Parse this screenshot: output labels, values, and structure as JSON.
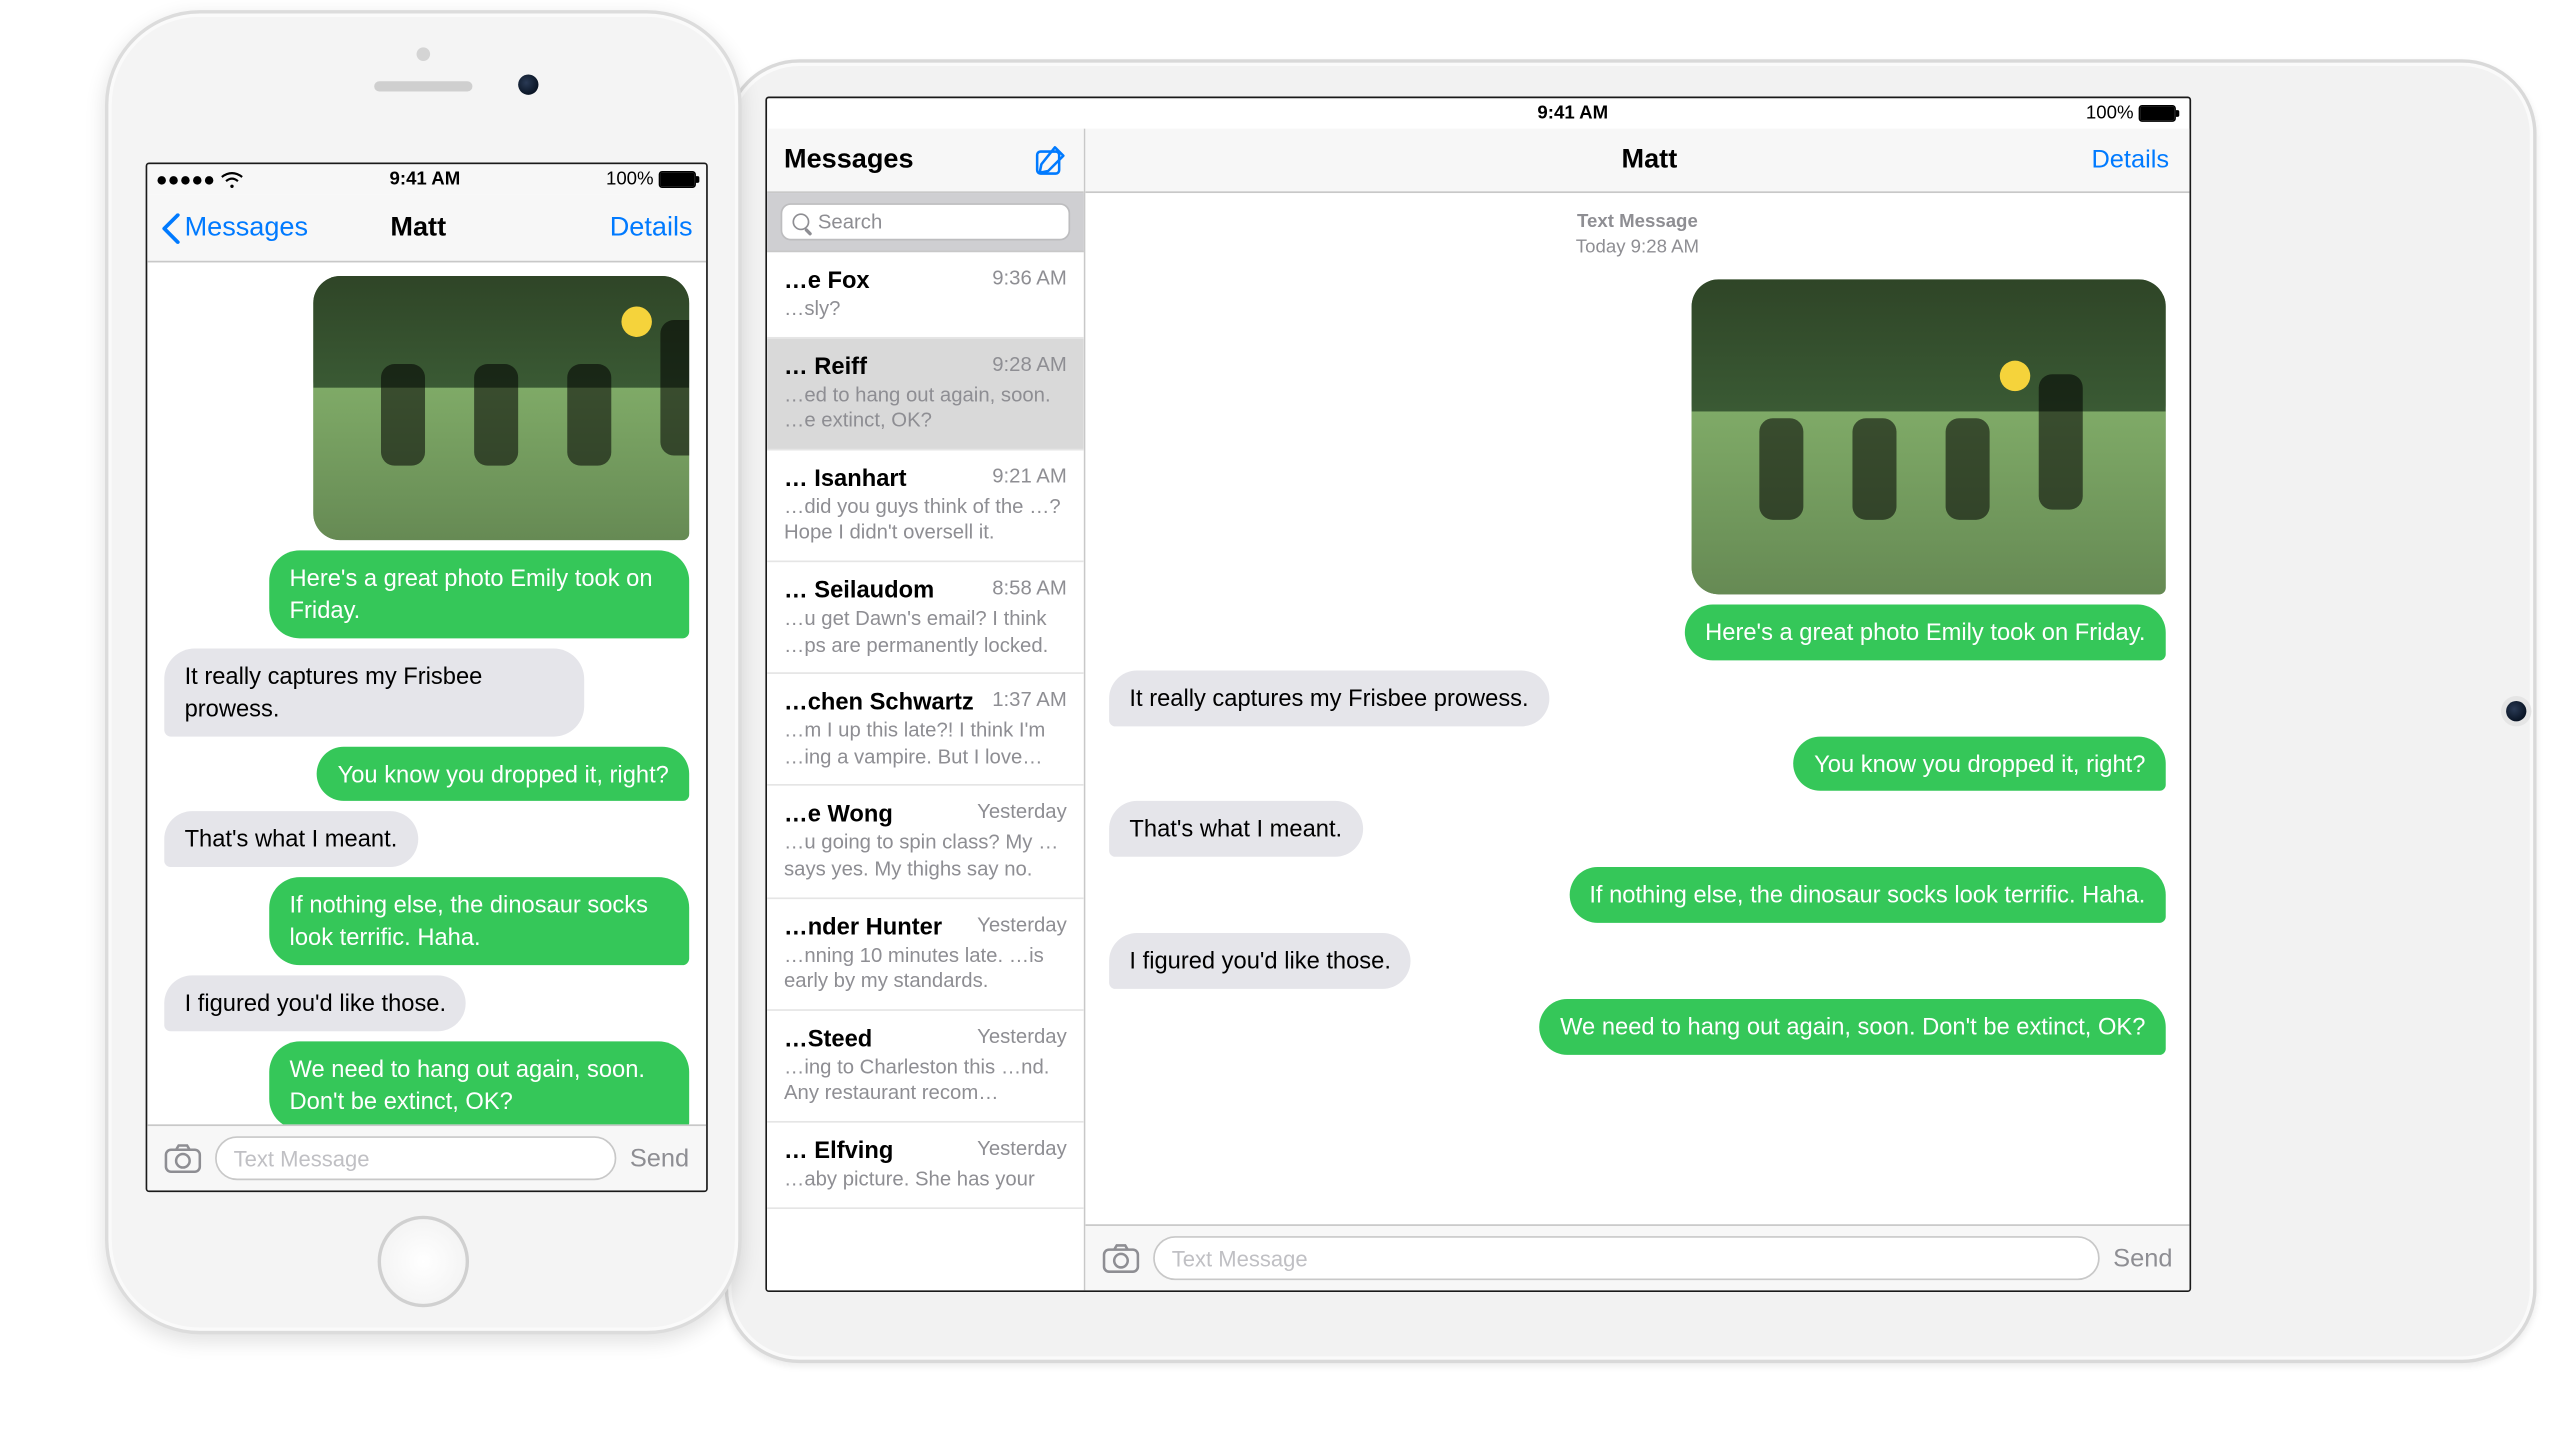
{
  "status": {
    "time": "9:41 AM",
    "battery_pct": "100%"
  },
  "iphone": {
    "back_label": "Messages",
    "title": "Matt",
    "details_label": "Details",
    "composer": {
      "placeholder": "Text Message",
      "send_label": "Send"
    },
    "messages": [
      {
        "from": "me",
        "type": "photo"
      },
      {
        "from": "me",
        "text": "Here's a great photo Emily took on Friday."
      },
      {
        "from": "them",
        "text": "It really captures my Frisbee prowess."
      },
      {
        "from": "me",
        "text": "You know you dropped it, right?"
      },
      {
        "from": "them",
        "text": "That's what I meant."
      },
      {
        "from": "me",
        "text": "If nothing else, the dinosaur socks look terrific. Haha."
      },
      {
        "from": "them",
        "text": "I figured you'd like those."
      },
      {
        "from": "me",
        "text": "We need to hang out again, soon. Don't be extinct, OK?"
      }
    ]
  },
  "ipad": {
    "sidebar": {
      "title": "Messages",
      "search_placeholder": "Search",
      "conversations": [
        {
          "name": "…e Fox",
          "time": "9:36 AM",
          "preview": "…sly?"
        },
        {
          "name": "… Reiff",
          "time": "9:28 AM",
          "preview": "…ed to hang out again, soon. …e extinct, OK?",
          "selected": true
        },
        {
          "name": "… Isanhart",
          "time": "9:21 AM",
          "preview": "…did you guys think of the …? Hope I didn't oversell it."
        },
        {
          "name": "… Seilaudom",
          "time": "8:58 AM",
          "preview": "…u get Dawn's email? I think …ps are permanently locked."
        },
        {
          "name": "…chen Schwartz",
          "time": "1:37 AM",
          "preview": "…m I up this late?! I think I'm …ing a vampire. But I love…"
        },
        {
          "name": "…e Wong",
          "time": "Yesterday",
          "preview": "…u going to spin class? My …says yes. My thighs say no."
        },
        {
          "name": "…nder Hunter",
          "time": "Yesterday",
          "preview": "…nning 10 minutes late. …is early by my standards."
        },
        {
          "name": "…Steed",
          "time": "Yesterday",
          "preview": "…ing to Charleston this …nd. Any restaurant recom…"
        },
        {
          "name": "… Elfving",
          "time": "Yesterday",
          "preview": "…aby picture. She has your"
        }
      ]
    },
    "main": {
      "title": "Matt",
      "details_label": "Details",
      "timestamp_label": "Text Message",
      "timestamp_time": "Today 9:28 AM",
      "composer": {
        "placeholder": "Text Message",
        "send_label": "Send"
      },
      "messages": [
        {
          "from": "me",
          "type": "photo"
        },
        {
          "from": "me",
          "text": "Here's a great photo Emily took on Friday."
        },
        {
          "from": "them",
          "text": "It really captures my Frisbee prowess."
        },
        {
          "from": "me",
          "text": "You know you dropped it, right?"
        },
        {
          "from": "them",
          "text": "That's what I meant."
        },
        {
          "from": "me",
          "text": "If nothing else, the dinosaur socks look terrific. Haha."
        },
        {
          "from": "them",
          "text": "I figured you'd like those."
        },
        {
          "from": "me",
          "text": "We need to hang out again, soon. Don't be extinct, OK?"
        }
      ]
    }
  }
}
